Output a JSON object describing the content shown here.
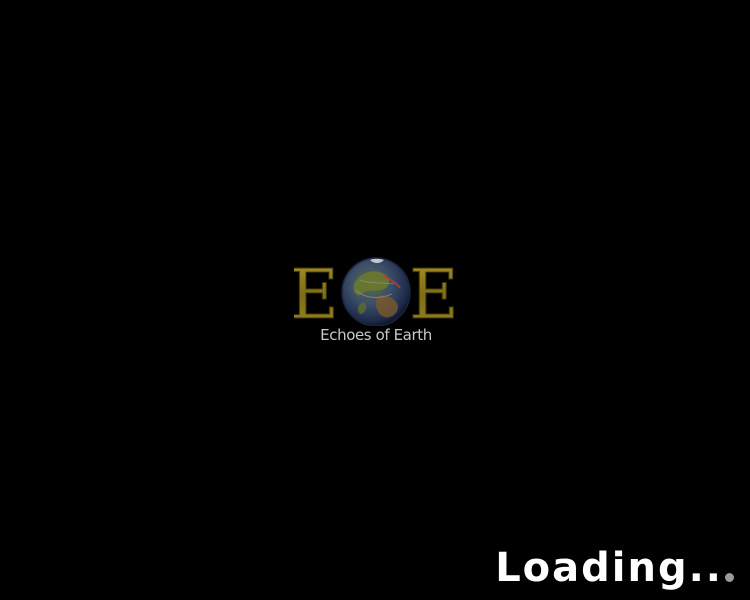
{
  "splash": {
    "background_color": "#000000",
    "logo": {
      "left_letter": "E",
      "right_letter": "E",
      "caption": "Echoes of Earth",
      "letter_color": "#8a7a1c",
      "icon": "globe-icon"
    },
    "loading": {
      "text": "Loading..",
      "text_color": "#ffffff",
      "indicator_icon": "progress-dot-icon",
      "indicator_color": "#9a9a9a"
    }
  }
}
